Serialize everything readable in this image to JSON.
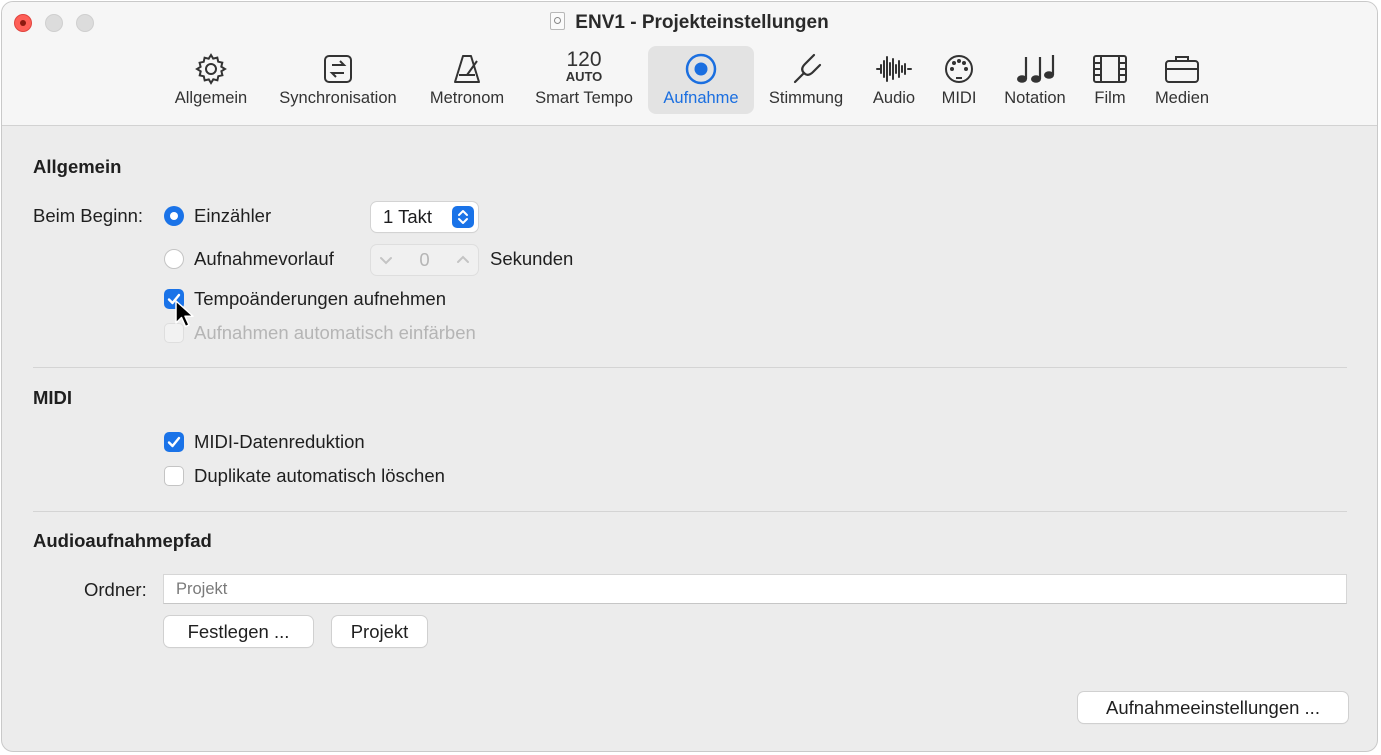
{
  "window": {
    "title": "ENV1 - Projekteinstellungen"
  },
  "toolbar": {
    "items": [
      {
        "label": "Allgemein",
        "icon": "gear-icon"
      },
      {
        "label": "Synchronisation",
        "icon": "sync-icon"
      },
      {
        "label": "Metronom",
        "icon": "metronome-icon"
      },
      {
        "label": "Smart Tempo",
        "icon": "smart-tempo-icon",
        "icon_number": "120",
        "icon_text": "AUTO"
      },
      {
        "label": "Aufnahme",
        "icon": "record-icon",
        "selected": true
      },
      {
        "label": "Stimmung",
        "icon": "tuning-fork-icon"
      },
      {
        "label": "Audio",
        "icon": "waveform-icon"
      },
      {
        "label": "MIDI",
        "icon": "midi-icon"
      },
      {
        "label": "Notation",
        "icon": "notes-icon"
      },
      {
        "label": "Film",
        "icon": "film-icon"
      },
      {
        "label": "Medien",
        "icon": "briefcase-icon"
      }
    ],
    "selected_color": "#1b6fe0"
  },
  "general": {
    "title": "Allgemein",
    "start_label": "Beim Beginn:",
    "countin_label": "Einzähler",
    "countin_selected": true,
    "countin_value": "1 Takt",
    "preroll_label": "Aufnahmevorlauf",
    "preroll_value": "0",
    "preroll_unit": "Sekunden",
    "tempo_label": "Tempoänderungen aufnehmen",
    "tempo_checked": true,
    "autocolor_label": "Aufnahmen automatisch einfärben",
    "autocolor_enabled": false
  },
  "midi": {
    "title": "MIDI",
    "reduction_label": "MIDI-Datenreduktion",
    "reduction_checked": true,
    "duplicates_label": "Duplikate automatisch löschen",
    "duplicates_checked": false
  },
  "audio_path": {
    "title": "Audioaufnahmepfad",
    "folder_label": "Ordner:",
    "folder_placeholder": "Projekt",
    "set_button": "Festlegen ...",
    "project_button": "Projekt"
  },
  "footer": {
    "settings_button": "Aufnahmeeinstellungen ..."
  },
  "colors": {
    "accent": "#1a73e8",
    "close": "#fe5f57"
  }
}
